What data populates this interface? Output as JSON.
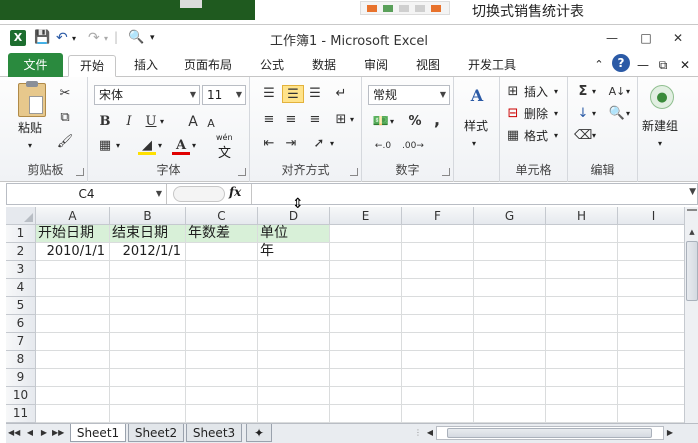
{
  "background_window": {
    "title": "切换式销售统计表"
  },
  "window": {
    "title": "工作簿1 - Microsoft Excel",
    "app_icon": "X",
    "controls": [
      "minimize-icon",
      "maximize-icon",
      "close-icon"
    ]
  },
  "tabs": [
    "文件",
    "开始",
    "插入",
    "页面布局",
    "公式",
    "数据",
    "审阅",
    "视图",
    "开发工具"
  ],
  "ribbon": {
    "clipboard": {
      "label": "剪贴板",
      "paste": "粘贴"
    },
    "font": {
      "label": "字体",
      "name": "宋体",
      "size": "11",
      "bold": "B",
      "italic": "I",
      "underline": "U",
      "grow": "A",
      "shrink": "A",
      "wen": "wén",
      "wen_char": "文"
    },
    "alignment": {
      "label": "对齐方式"
    },
    "number": {
      "label": "数字",
      "format": "常规",
      "percent": "%",
      "comma": ","
    },
    "styles": {
      "label": "样式"
    },
    "cells": {
      "label": "单元格",
      "insert": "插入",
      "delete": "删除",
      "format": "格式"
    },
    "editing": {
      "label": "编辑"
    },
    "newgroup": {
      "label": "新建组"
    }
  },
  "formula_bar": {
    "cell_ref": "C4",
    "fx": "fx",
    "content": ""
  },
  "grid": {
    "columns": [
      "A",
      "B",
      "C",
      "D",
      "E",
      "F",
      "G",
      "H",
      "I"
    ],
    "rows": [
      "1",
      "2",
      "3",
      "4",
      "5",
      "6",
      "7",
      "8",
      "9",
      "10",
      "11"
    ],
    "cells": {
      "A1": "开始日期",
      "B1": "结束日期",
      "C1": "年数差",
      "D1": "单位",
      "A2": "2010/1/1",
      "B2": "2012/1/1",
      "D2": "年"
    }
  },
  "sheets": [
    "Sheet1",
    "Sheet2",
    "Sheet3"
  ],
  "active_sheet": "Sheet1"
}
